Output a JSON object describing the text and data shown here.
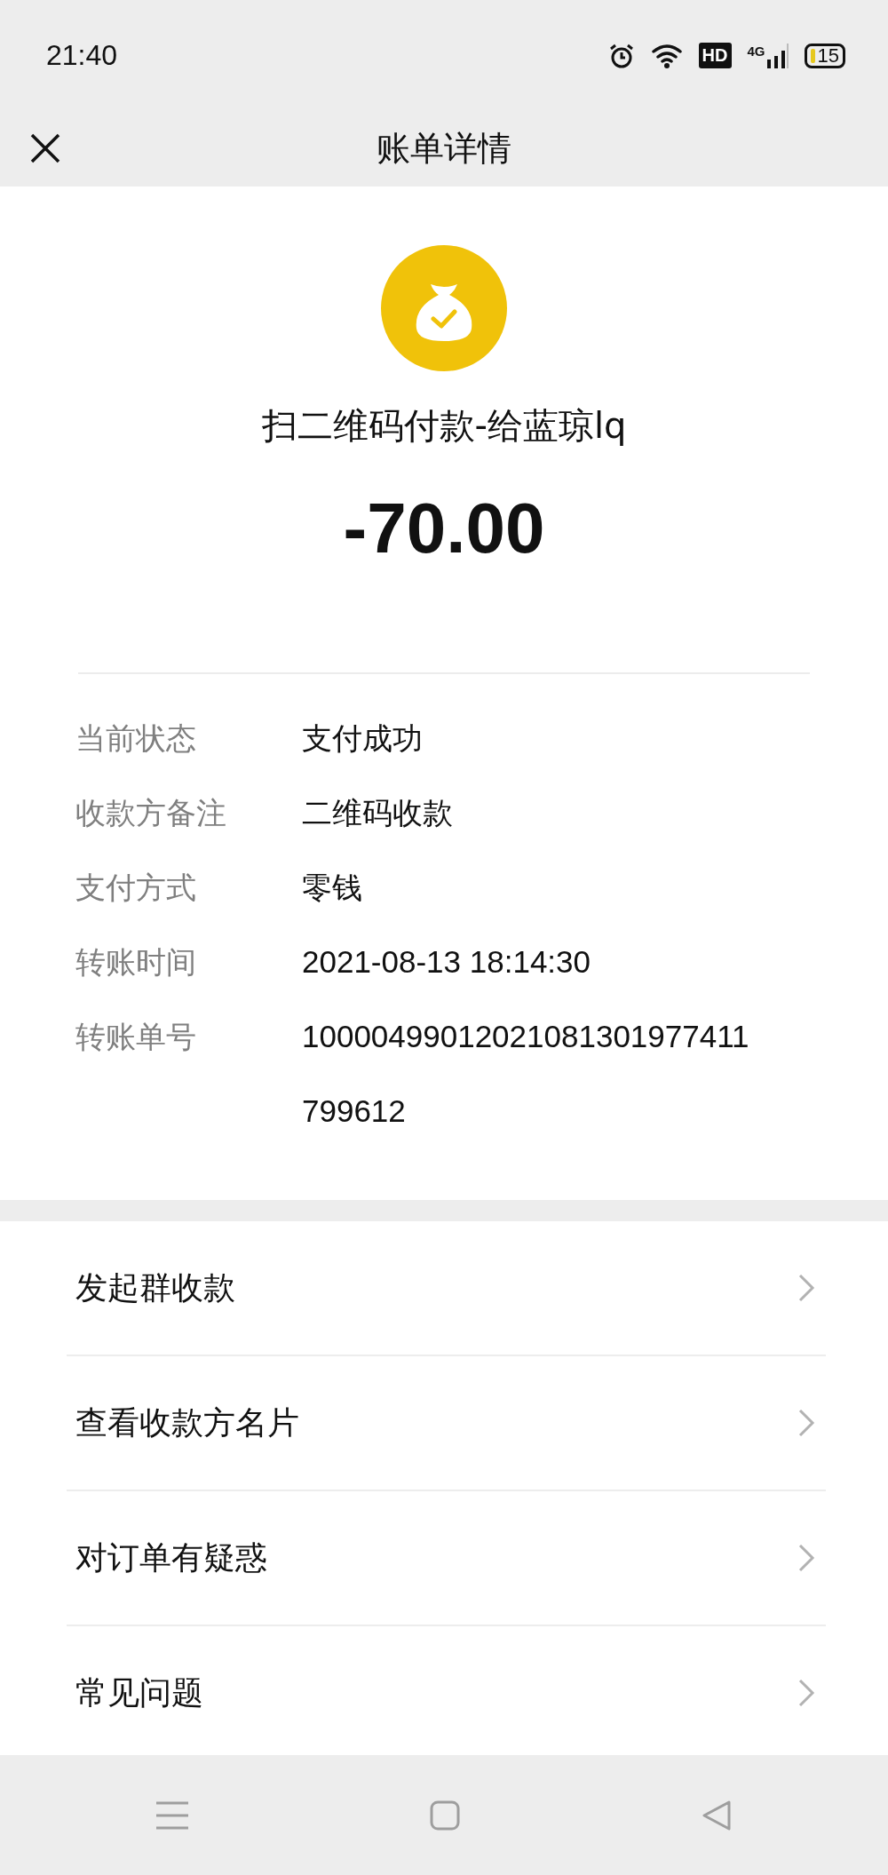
{
  "status_bar": {
    "time": "21:40",
    "hd": "HD",
    "network": "4G",
    "battery": "15"
  },
  "header": {
    "title": "账单详情"
  },
  "bill": {
    "title": "扫二维码付款-给蓝琼lq",
    "amount": "-70.00",
    "details": [
      {
        "label": "当前状态",
        "value": "支付成功"
      },
      {
        "label": "收款方备注",
        "value": "二维码收款"
      },
      {
        "label": "支付方式",
        "value": "零钱"
      },
      {
        "label": "转账时间",
        "value": "2021-08-13 18:14:30"
      },
      {
        "label": "转账单号",
        "value": "10000499012021081301977411799612"
      }
    ]
  },
  "actions": [
    {
      "label": "发起群收款"
    },
    {
      "label": "查看收款方名片"
    },
    {
      "label": "对订单有疑惑"
    },
    {
      "label": "常见问题"
    }
  ]
}
